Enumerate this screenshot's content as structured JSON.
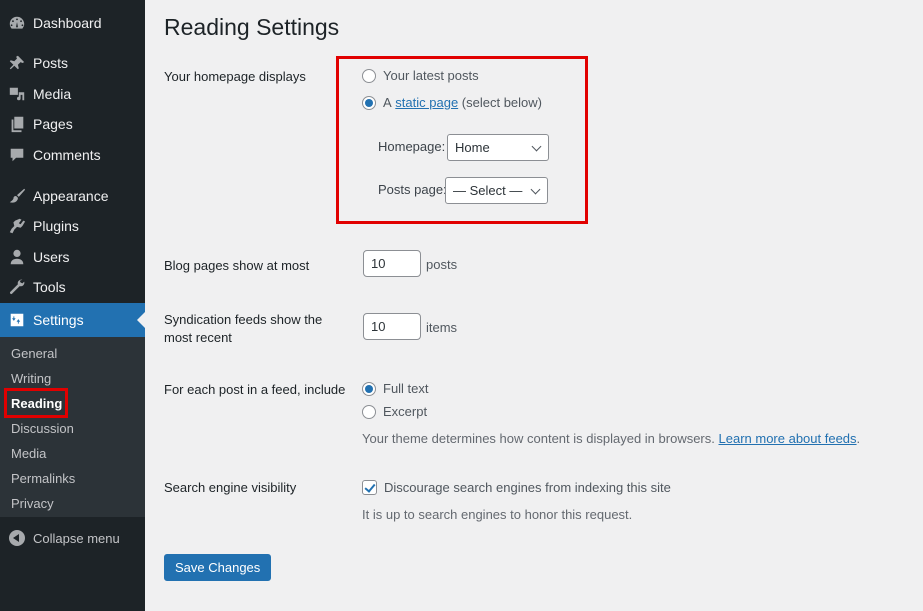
{
  "sidebar": {
    "menu": [
      {
        "label": "Dashboard",
        "icon": "dashboard-icon"
      },
      {
        "label": "Posts",
        "icon": "pin-icon"
      },
      {
        "label": "Media",
        "icon": "media-icon"
      },
      {
        "label": "Pages",
        "icon": "pages-icon"
      },
      {
        "label": "Comments",
        "icon": "comments-icon"
      },
      {
        "label": "Appearance",
        "icon": "paintbrush-icon"
      },
      {
        "label": "Plugins",
        "icon": "plugin-icon"
      },
      {
        "label": "Users",
        "icon": "user-icon"
      },
      {
        "label": "Tools",
        "icon": "wrench-icon"
      },
      {
        "label": "Settings",
        "icon": "settings-icon",
        "active": true
      }
    ],
    "submenu": [
      {
        "label": "General"
      },
      {
        "label": "Writing"
      },
      {
        "label": "Reading",
        "current": true
      },
      {
        "label": "Discussion"
      },
      {
        "label": "Media"
      },
      {
        "label": "Permalinks"
      },
      {
        "label": "Privacy"
      }
    ],
    "collapse_label": "Collapse menu"
  },
  "page": {
    "title": "Reading Settings",
    "homepage_displays": {
      "label": "Your homepage displays",
      "option_latest": "Your latest posts",
      "option_static_prefix": "A",
      "option_static_link": "static page",
      "option_static_suffix": "(select below)",
      "selected": "static",
      "homepage_label": "Homepage:",
      "homepage_value": "Home",
      "posts_page_label": "Posts page:",
      "posts_page_value": "— Select —"
    },
    "blog_pages": {
      "label": "Blog pages show at most",
      "value": "10",
      "unit": "posts"
    },
    "syndication": {
      "label_line1": "Syndication feeds show the",
      "label_line2": "most recent",
      "value": "10",
      "unit": "items"
    },
    "feed_include": {
      "label": "For each post in a feed, include",
      "option_full": "Full text",
      "option_excerpt": "Excerpt",
      "selected": "full",
      "description": "Your theme determines how content is displayed in browsers.",
      "link": "Learn more about feeds",
      "link_suffix": "."
    },
    "search_visibility": {
      "label": "Search engine visibility",
      "checkbox_label": "Discourage search engines from indexing this site",
      "checked": true,
      "description": "It is up to search engines to honor this request."
    },
    "save_label": "Save Changes"
  },
  "colors": {
    "sidebar_bg": "#1d2327",
    "submenu_bg": "#2c3338",
    "accent": "#2271b1",
    "highlight": "#e10000",
    "page_bg": "#f0f0f1"
  }
}
